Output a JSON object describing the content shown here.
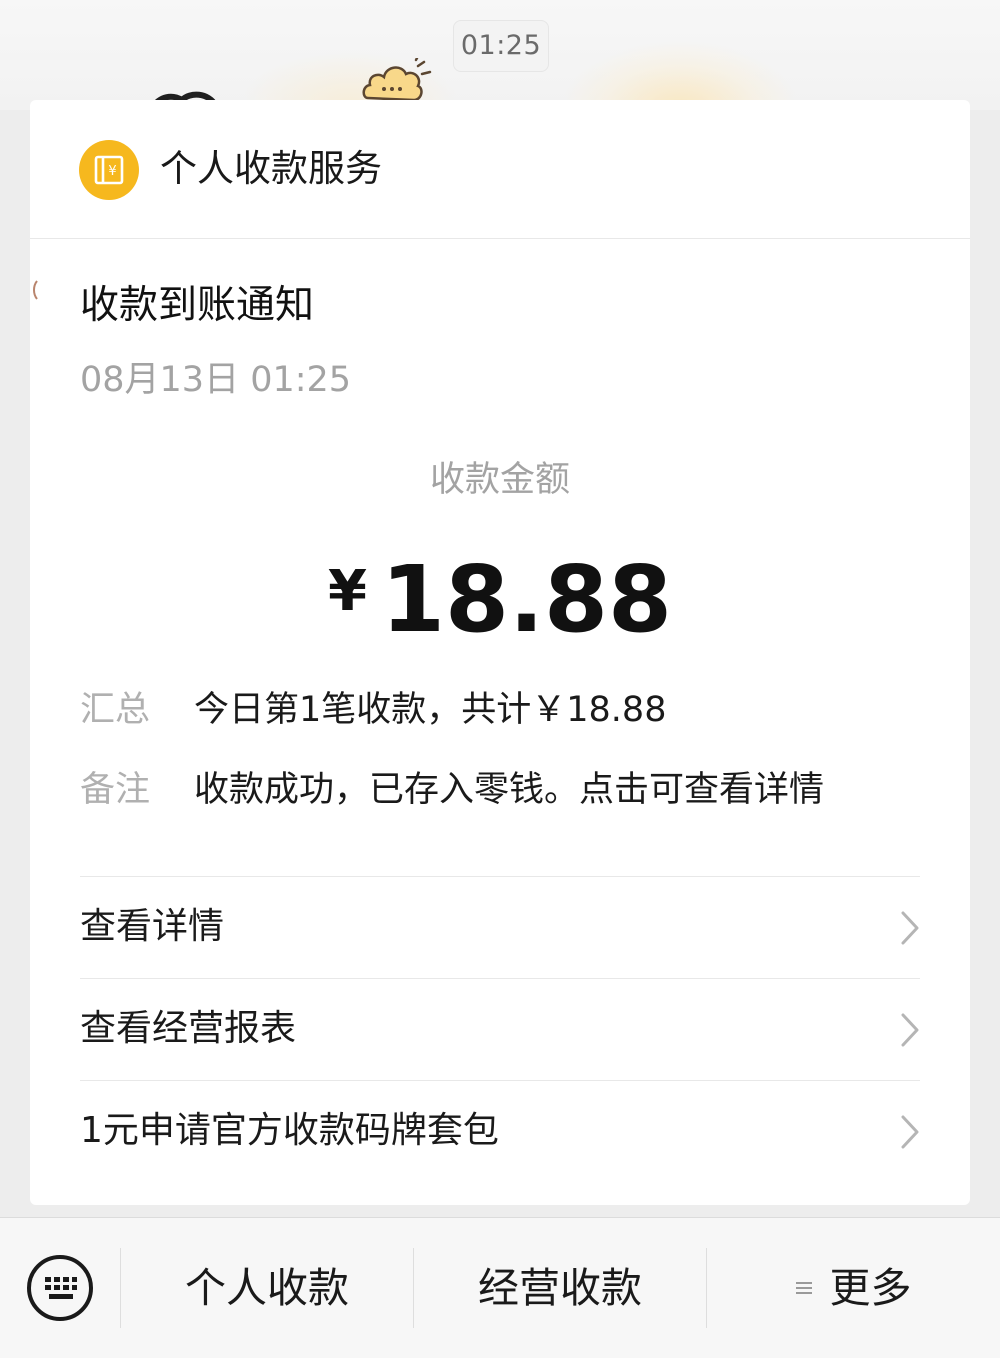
{
  "chat": {
    "timestamp": "01:25"
  },
  "header": {
    "service_name": "个人收款服务",
    "logo_glyph": "¥"
  },
  "notice": {
    "title": "收款到账通知",
    "datetime": "08月13日 01:25",
    "amount_label": "收款金额",
    "currency_symbol": "¥",
    "amount": "18.88",
    "summary_label": "汇总",
    "summary_value": "今日第1笔收款，共计￥18.88",
    "remark_label": "备注",
    "remark_value": "收款成功，已存入零钱。点击可查看详情"
  },
  "links": [
    {
      "label": "查看详情"
    },
    {
      "label": "查看经营报表"
    },
    {
      "label": "1元申请官方收款码牌套包"
    }
  ],
  "bottom_menu": {
    "personal": "个人收款",
    "business": "经营收款",
    "more": "更多"
  },
  "icons": {
    "service_logo": "wallet-yen-icon",
    "keyboard": "keyboard-icon",
    "chevron": "chevron-right-icon",
    "menu": "menu-lines-icon"
  },
  "colors": {
    "accent": "#f6b81e",
    "secondary_text": "#a3a3a3",
    "card_background": "#ffffff",
    "page_background": "#ededed"
  }
}
